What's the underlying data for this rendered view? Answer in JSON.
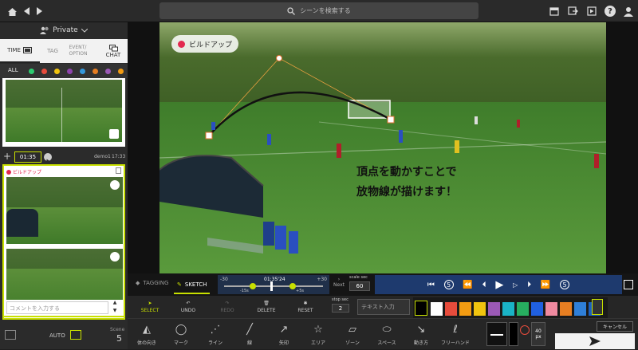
{
  "topbar": {
    "search_placeholder": "シーンを検索する",
    "icons": [
      "home-icon",
      "back-icon",
      "forward-icon",
      "calendar-icon",
      "export-icon",
      "video-icon",
      "help-icon",
      "profile-icon"
    ]
  },
  "sidebar": {
    "workspace": "Private",
    "tabs": {
      "time": "TIME",
      "tag": "TAG",
      "event": "EVENT/\nOPTION",
      "chat": "CHAT"
    },
    "filter_all": "ALL",
    "filter_colors": [
      "#2ecc71",
      "#e74c3c",
      "#f1c40f",
      "#8e44ad",
      "#3498db",
      "#e67e22",
      "#9b59b6",
      "#f39c12"
    ],
    "clip": {
      "time": "01:35",
      "author": "demo1",
      "clock": "17:33",
      "tag": "ビルドアップ",
      "comment_placeholder": "コメントを入力する"
    },
    "bottom": {
      "auto": "AUTO",
      "scene_label": "Scene",
      "scene_count": "5"
    }
  },
  "video": {
    "tag": "ビルドアップ",
    "caption_line1": "頂点を動かすことで",
    "caption_line2": "放物線が描けます！"
  },
  "controls": {
    "tab_tagging": "TAGGING",
    "tab_sketch": "SKETCH",
    "tl_left": "-30",
    "tl_center": "01:35'24",
    "tl_right": "+30",
    "tl_minus": "-15s",
    "tl_plus": "+5s",
    "next_label": "Next",
    "scale_label": "scale",
    "scale_unit": "sec",
    "scale_value": "60"
  },
  "tools1": {
    "select": "SELECT",
    "undo": "UNDO",
    "redo": "REDO",
    "delete": "DELETE",
    "reset": "RESET",
    "stop_label": "stop",
    "stop_unit": "sec",
    "stop_value": "2",
    "text_placeholder": "テキスト入力",
    "colors": [
      "#ffffff",
      "#e74c3c",
      "#f39c12",
      "#f1c40f",
      "#9b59b6",
      "#1ab3c6",
      "#27ae60",
      "#2060e0",
      "#f08aa0",
      "#e67e22",
      "#2f7fd8",
      "#1a5fc0"
    ]
  },
  "tools2": {
    "items": [
      "体の向き",
      "マーク",
      "ライン",
      "線",
      "矢印",
      "エリア",
      "ゾーン",
      "スペース",
      "動き方",
      "フリーハンド"
    ],
    "size_value": "40",
    "size_unit": "px",
    "cancel": "キャンセル"
  }
}
